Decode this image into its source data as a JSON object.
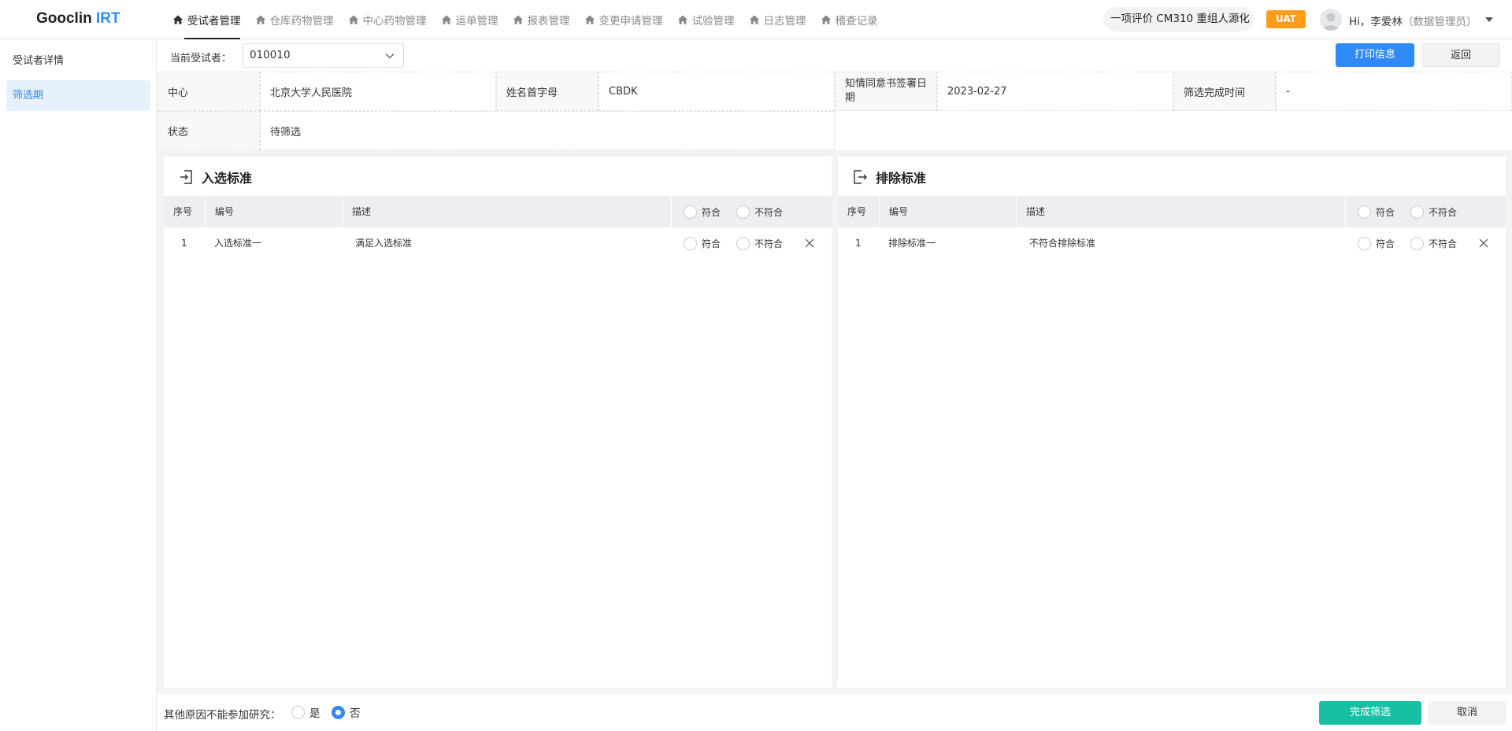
{
  "app": {
    "logo_main": "Gooclin",
    "logo_accent": " IRT"
  },
  "nav": {
    "items": [
      {
        "label": "受试者管理",
        "icon": "home-icon"
      },
      {
        "label": "仓库药物管理",
        "icon": "home-icon"
      },
      {
        "label": "中心药物管理",
        "icon": "home-icon"
      },
      {
        "label": "运单管理",
        "icon": "home-icon"
      },
      {
        "label": "报表管理",
        "icon": "home-icon"
      },
      {
        "label": "变更申请管理",
        "icon": "home-icon"
      },
      {
        "label": "试验管理",
        "icon": "home-icon"
      },
      {
        "label": "日志管理",
        "icon": "home-icon"
      },
      {
        "label": "稽查记录",
        "icon": "home-icon"
      }
    ],
    "active_index": 0
  },
  "header": {
    "project_name": "一项评价 CM310 重组人源化",
    "env_badge": "UAT",
    "greeting": "Hi，李爱林",
    "role": "（数据管理员）"
  },
  "sidebar": {
    "items": [
      {
        "label": "受试者详情"
      },
      {
        "label": "筛选期"
      }
    ],
    "active_index": 1
  },
  "topbar": {
    "subject_label": "当前受试者：",
    "subject_value": "010010",
    "print_button": "打印信息",
    "back_button": "返回"
  },
  "info": {
    "center_label": "中心",
    "center_value": "北京大学人民医院",
    "initials_label": "姓名首字母",
    "initials_value": "CBDK",
    "consent_label": "知情同意书签署日期",
    "consent_value": "2023-02-27",
    "screen_done_label": "筛选完成时间",
    "screen_done_value": "-",
    "status_label": "状态",
    "status_value": "待筛选"
  },
  "inclusion": {
    "title": "入选标准",
    "columns": {
      "index": "序号",
      "code": "编号",
      "desc": "描述",
      "meet": "符合",
      "not_meet": "不符合"
    },
    "rows": [
      {
        "index": "1",
        "code": "入选标准一",
        "desc": "满足入选标准"
      }
    ]
  },
  "exclusion": {
    "title": "排除标准",
    "columns": {
      "index": "序号",
      "code": "编号",
      "desc": "描述",
      "meet": "符合",
      "not_meet": "不符合"
    },
    "rows": [
      {
        "index": "1",
        "code": "排除标准一",
        "desc": "不符合排除标准"
      }
    ]
  },
  "footer": {
    "reason_label": "其他原因不能参加研究：",
    "yes_label": "是",
    "no_label": "否",
    "selected": "否",
    "complete_button": "完成筛选",
    "cancel_button": "取消"
  },
  "colors": {
    "primary": "#2f8af5",
    "success": "#17c0a5",
    "badge": "#ff9c1a"
  }
}
